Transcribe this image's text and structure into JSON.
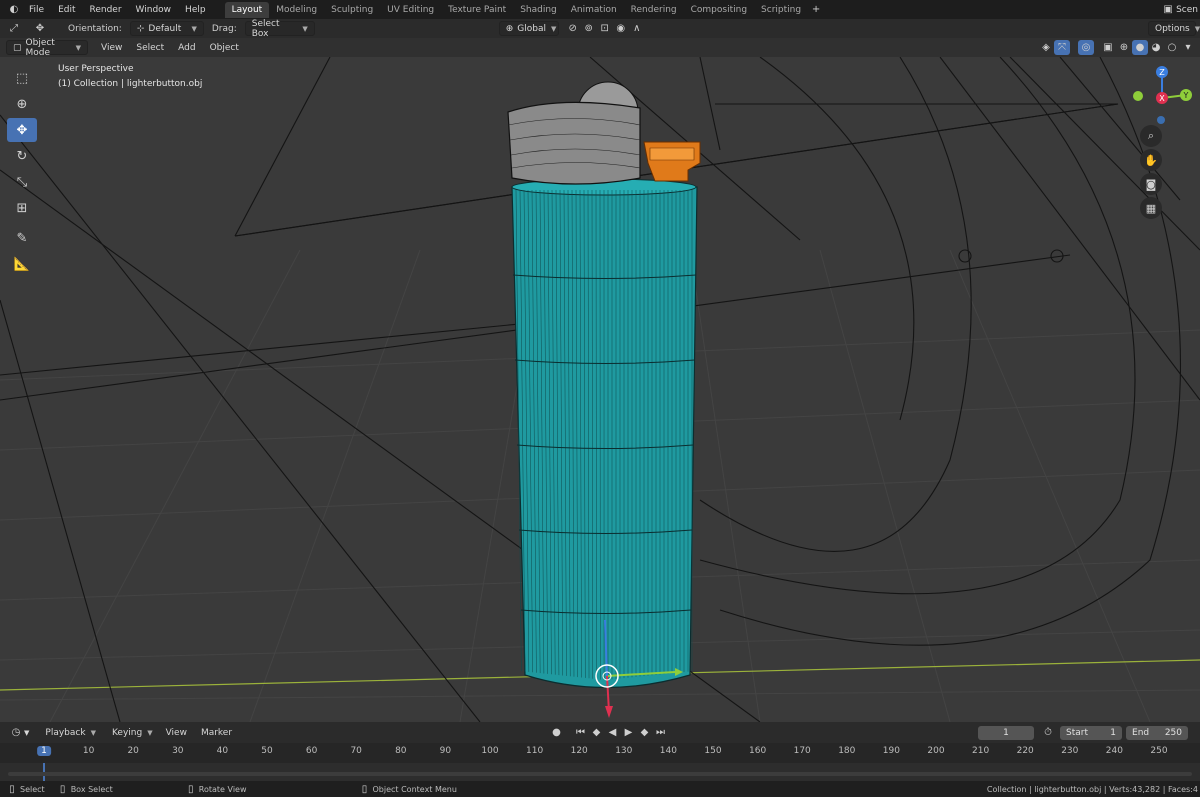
{
  "topbar": {
    "menus": [
      "File",
      "Edit",
      "Render",
      "Window",
      "Help"
    ],
    "workspaces": [
      "Layout",
      "Modeling",
      "Sculpting",
      "UV Editing",
      "Texture Paint",
      "Shading",
      "Animation",
      "Rendering",
      "Compositing",
      "Scripting"
    ],
    "active_workspace": "Layout",
    "scene_label": "Scen"
  },
  "toolheader": {
    "orientation_label": "Orientation:",
    "orientation_value": "Default",
    "drag_label": "Drag:",
    "drag_value": "Select Box",
    "transform_orientation": "Global",
    "options_label": "Options"
  },
  "viewheader": {
    "mode": "Object Mode",
    "menus": [
      "View",
      "Select",
      "Add",
      "Object"
    ]
  },
  "viewport": {
    "perspective_label": "User Perspective",
    "collection_label": "(1) Collection | lighterbutton.obj",
    "colors": {
      "body": "#1f9aa0",
      "cap": "#e07a1a",
      "wire": "#111111",
      "x_axis": "#a0b83a"
    }
  },
  "gizmo": {
    "x": "X",
    "y": "Y",
    "z": "Z"
  },
  "timeline": {
    "menus": [
      "Playback",
      "Keying",
      "View",
      "Marker"
    ],
    "current_frame": "1",
    "start_label": "Start",
    "start_value": "1",
    "end_label": "End",
    "end_value": "250",
    "ruler": [
      "1",
      "10",
      "20",
      "30",
      "40",
      "50",
      "60",
      "70",
      "80",
      "90",
      "100",
      "110",
      "120",
      "130",
      "140",
      "150",
      "160",
      "170",
      "180",
      "190",
      "200",
      "210",
      "220",
      "230",
      "240",
      "250"
    ]
  },
  "statusbar": {
    "select": "Select",
    "box_select": "Box Select",
    "rotate_view": "Rotate View",
    "context_menu": "Object Context Menu",
    "stats": "Collection | lighterbutton.obj | Verts:43,282 | Faces:4"
  }
}
